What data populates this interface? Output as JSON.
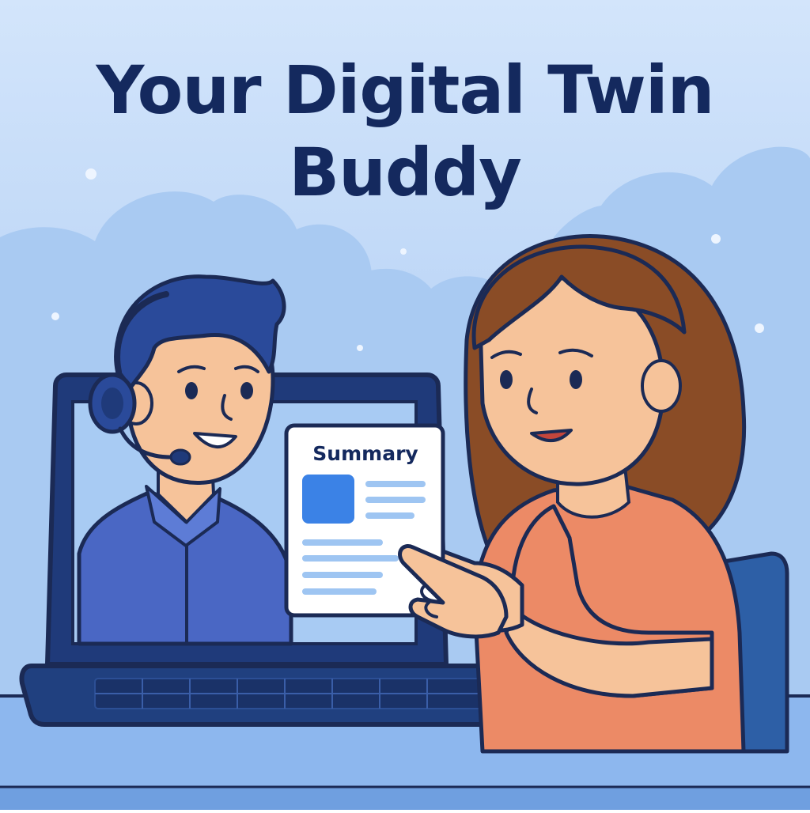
{
  "title": {
    "line1": "Your Digital Twin",
    "line2": "Buddy"
  },
  "card": {
    "heading": "Summary"
  },
  "colors": {
    "sky_top": "#cfe2fb",
    "sky_bottom": "#9fc3f2",
    "cloud": "#a9caf4",
    "title": "#14295e",
    "outline": "#1b2a55",
    "laptop": "#1f3a7a",
    "screen": "#a8cbf3",
    "man_shirt": "#4a67c4",
    "man_hair": "#2a4a9a",
    "skin": "#f6c39a",
    "woman_hair": "#8a4c26",
    "woman_shirt": "#ec8a66",
    "card_accent": "#3b82e6",
    "card_line": "#9ec5f2",
    "chair": "#2d5fa6",
    "desk": "#8eb8ee"
  },
  "icons": {
    "headset": "headset-icon",
    "image_block": "image-placeholder-icon"
  }
}
